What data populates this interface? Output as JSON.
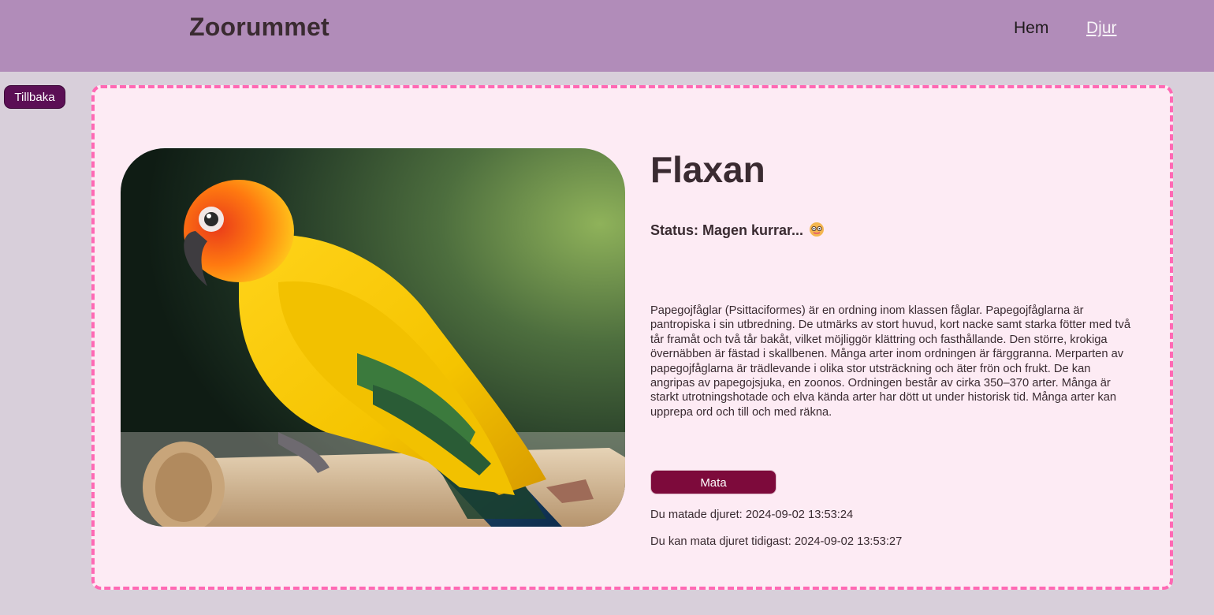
{
  "header": {
    "brand": "Zoorummet",
    "nav": [
      {
        "label": "Hem"
      },
      {
        "label": "Djur"
      }
    ]
  },
  "back_button": {
    "label": "Tillbaka"
  },
  "animal": {
    "name": "Flaxan",
    "status": "Status: Magen kurrar...",
    "status_icon": "hungry-face-emoji-icon",
    "photo_icon": "parrot-photo",
    "description": "Papegojfåglar (Psittaciformes) är en ordning inom klassen fåglar. Papegojfåglarna är pantropiska i sin utbredning. De utmärks av stort huvud, kort nacke samt starka fötter med två tår framåt och två tår bakåt, vilket möjliggör klättring och fasthållande. Den större, krokiga övernäbben är fästad i skallbenen. Många arter inom ordningen är färggranna. Merparten av papegojfåglarna är trädlevande i olika stor utsträckning och äter frön och frukt. De kan angripas av papegojsjuka, en zoonos. Ordningen består av cirka 350–370 arter. Många är starkt utrotningshotade och elva kända arter har dött ut under historisk tid. Många arter kan upprepa ord och till och med räkna.",
    "feed_button": "Mata",
    "fed_at": "Du matade djuret: 2024-09-02 13:53:24",
    "next_feed": "Du kan mata djuret tidigast: 2024-09-02 13:53:27"
  },
  "colors": {
    "header_bg": "#b18cb9",
    "page_bg": "#d8cfda",
    "card_bg": "#fdebf4",
    "card_border": "#ff69b4",
    "back_button_bg": "#5b0f55",
    "feed_button_bg": "#7d0a3b"
  }
}
